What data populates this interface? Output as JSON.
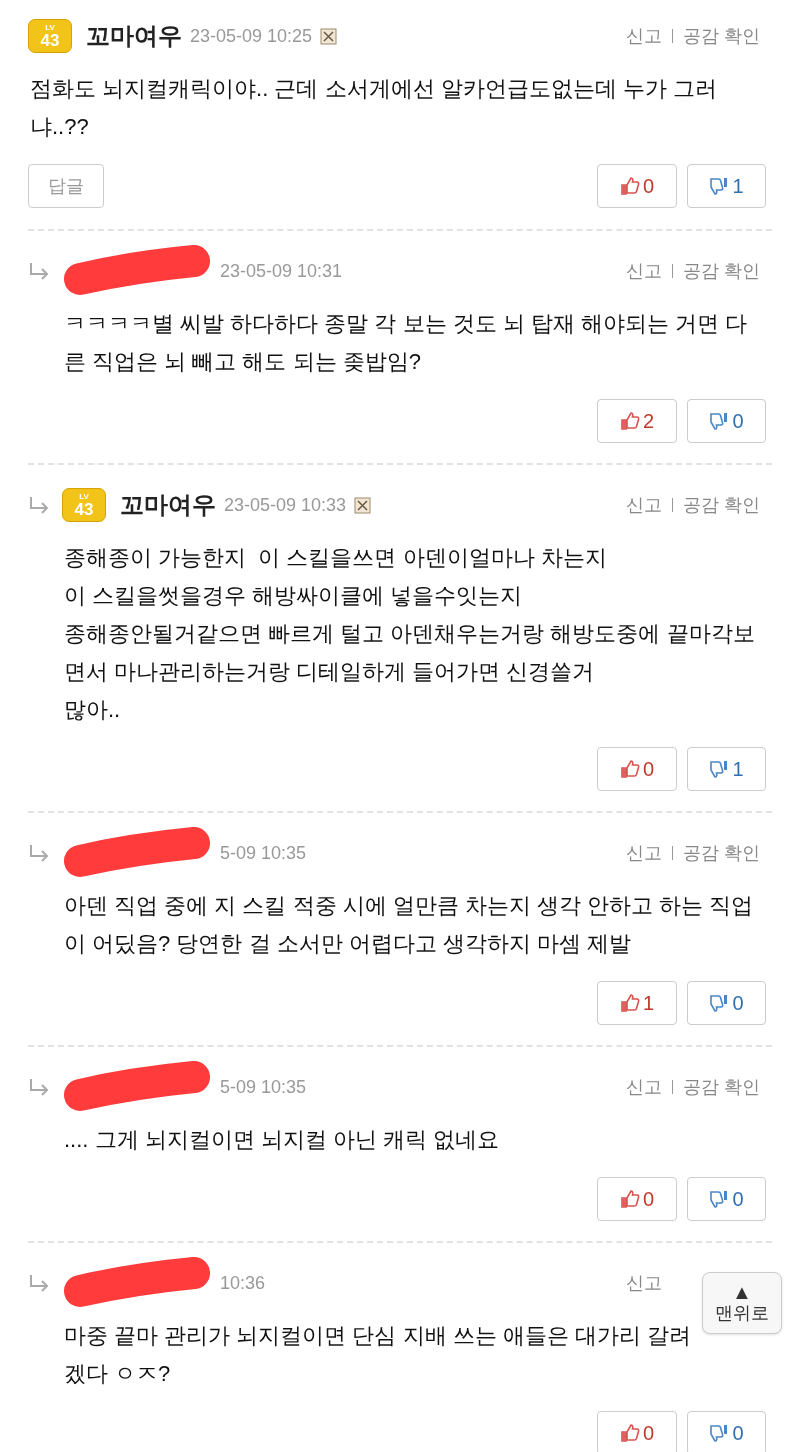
{
  "comments": [
    {
      "kind": "comment",
      "redacted": false,
      "author": "꼬마여우",
      "badge": {
        "label": "LV",
        "level": "43"
      },
      "time": "23-05-09 10:25",
      "actions": [
        "신고",
        "공감 확인"
      ],
      "lines": [
        "점화도 뇌지컬캐릭이야.. 근데 소서게에선 알카언급도없는데 누가 그러",
        "냐..??"
      ],
      "reply_button": "답글",
      "likes": "0",
      "dislikes": "1"
    },
    {
      "kind": "reply",
      "redacted": true,
      "time": "23-05-09 10:31",
      "actions": [
        "신고",
        "공감 확인"
      ],
      "lines": [
        "ㅋㅋㅋㅋ별 씨발 하다하다 종말 각 보는 것도 뇌 탑재 해야되는 거면 다",
        "른 직업은 뇌 빼고 해도 되는 좆밥임?"
      ],
      "likes": "2",
      "dislikes": "0"
    },
    {
      "kind": "reply",
      "redacted": false,
      "author": "꼬마여우",
      "badge": {
        "label": "LV",
        "level": "43"
      },
      "time": "23-05-09 10:33",
      "actions": [
        "신고",
        "공감 확인"
      ],
      "lines": [
        "종해종이 가능한지  이 스킬을쓰면 아덴이얼마나 차는지",
        "이 스킬을썻을경우 해방싸이클에 넣을수잇는지",
        "종해종안될거같으면 빠르게 털고 아덴채우는거랑 해방도중에 끝마각보",
        "면서 마나관리하는거랑 디테일하게 들어가면 신경쓸거",
        "많아.."
      ],
      "likes": "0",
      "dislikes": "1"
    },
    {
      "kind": "reply",
      "redacted": true,
      "time": "5-09 10:35",
      "actions": [
        "신고",
        "공감 확인"
      ],
      "lines": [
        "아덴 직업 중에 지 스킬 적중 시에 얼만큼 차는지 생각 안하고 하는 직업",
        "이 어딨음? 당연한 걸 소서만 어렵다고 생각하지 마셈 제발"
      ],
      "likes": "1",
      "dislikes": "0"
    },
    {
      "kind": "reply",
      "redacted": true,
      "time": "5-09 10:35",
      "actions": [
        "신고",
        "공감 확인"
      ],
      "lines": [
        ".... 그게 뇌지컬이면 뇌지컬 아닌 캐릭 없네요"
      ],
      "likes": "0",
      "dislikes": "0"
    },
    {
      "kind": "reply",
      "redacted": true,
      "time": "10:36",
      "actions": [
        "신고"
      ],
      "lines": [
        "마중 끝마 관리가 뇌지컬이면 단심 지배 쓰는 애들은 대가리 갈려",
        "겠다 ㅇㅈ?"
      ],
      "likes": "0",
      "dislikes": "0"
    }
  ],
  "scroll_top_button": {
    "arrow": "▲",
    "label": "맨위로"
  }
}
